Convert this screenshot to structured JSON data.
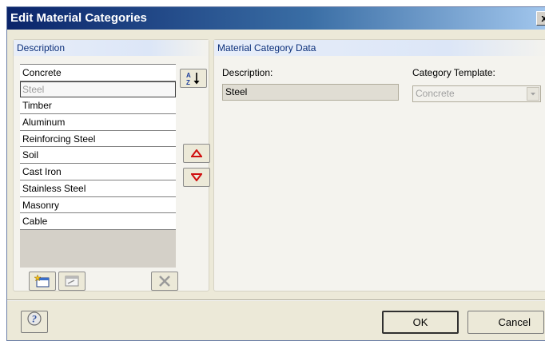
{
  "window": {
    "title": "Edit Material Categories",
    "close_label": "x"
  },
  "left_panel": {
    "header": "Description",
    "items": [
      {
        "label": "Concrete"
      },
      {
        "label": "Steel",
        "selected": true
      },
      {
        "label": "Timber"
      },
      {
        "label": "Aluminum"
      },
      {
        "label": "Reinforcing Steel"
      },
      {
        "label": "Soil"
      },
      {
        "label": "Cast Iron"
      },
      {
        "label": "Stainless Steel"
      },
      {
        "label": "Masonry"
      },
      {
        "label": "Cable"
      }
    ]
  },
  "right_panel": {
    "header": "Material Category Data",
    "description_label": "Description:",
    "description_value": "Steel",
    "template_label": "Category Template:",
    "template_value": "Concrete"
  },
  "footer": {
    "ok_label": "OK",
    "cancel_label": "Cancel"
  },
  "icons": {
    "sort": "sort-az-icon",
    "move_up": "arrow-up-icon",
    "move_down": "arrow-down-icon",
    "new": "new-category-icon",
    "edit": "edit-category-icon",
    "delete": "delete-icon",
    "help": "help-icon"
  },
  "colors": {
    "title_start": "#0a246a",
    "title_end": "#a6caf0",
    "panel_header_text": "#0b2f7a",
    "arrow_red": "#d01010"
  }
}
